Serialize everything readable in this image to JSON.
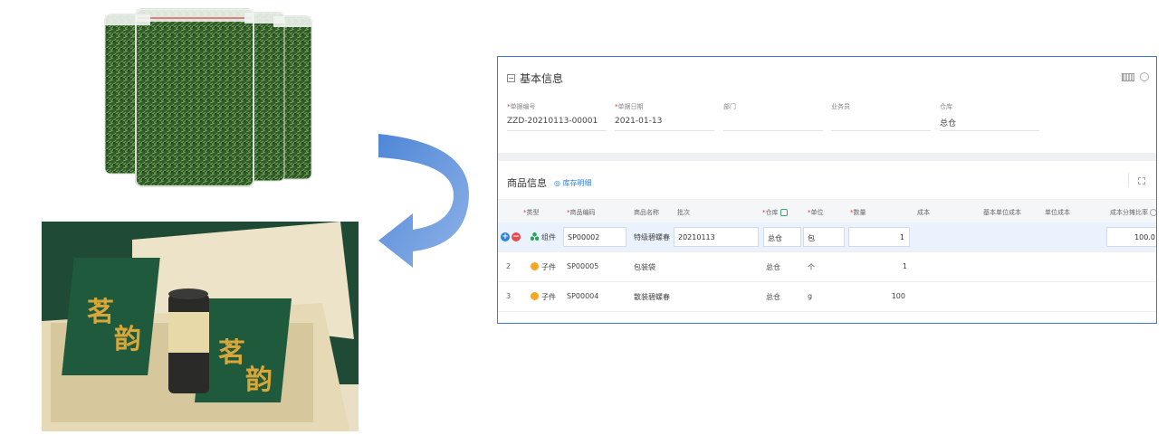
{
  "panel": {
    "section_basic": "基本信息",
    "fields": [
      {
        "label": "单据编号",
        "required": true,
        "value": "ZZD-20210113-00001"
      },
      {
        "label": "单据日期",
        "required": true,
        "value": "2021-01-13"
      },
      {
        "label": "部门",
        "required": false,
        "value": ""
      },
      {
        "label": "业务员",
        "required": false,
        "value": ""
      },
      {
        "label": "仓库",
        "required": false,
        "value": "总仓"
      }
    ],
    "section_goods": "商品信息",
    "stock_link": "库存明细",
    "columns": [
      "类型",
      "商品编码",
      "商品名称",
      "批次",
      "仓库",
      "单位",
      "数量",
      "成本",
      "基本单位成本",
      "单位成本",
      "成本分摊比率"
    ],
    "required_mark": "*",
    "rows": [
      {
        "num": "",
        "type": "组件",
        "code": "SP00002",
        "name": "特级碧螺春",
        "batch": "20210113",
        "warehouse": "总仓",
        "unit": "包",
        "qty": "1",
        "ratio": "100.0"
      },
      {
        "num": "2",
        "type": "子件",
        "code": "SP00005",
        "name": "包装袋",
        "batch": "",
        "warehouse": "总仓",
        "unit": "个",
        "qty": "1",
        "ratio": ""
      },
      {
        "num": "3",
        "type": "子件",
        "code": "SP00004",
        "name": "散装碧螺春",
        "batch": "",
        "warehouse": "总仓",
        "unit": "g",
        "qty": "100",
        "ratio": ""
      }
    ],
    "row_actions": {
      "add": "+",
      "remove": "−"
    }
  },
  "colors": {
    "accent": "#2f7fe0",
    "panel_border": "#3b7bd8",
    "arrow": "#5b8fd8",
    "tea_green": "#1e5a3a",
    "gold": "#d9a63a"
  }
}
